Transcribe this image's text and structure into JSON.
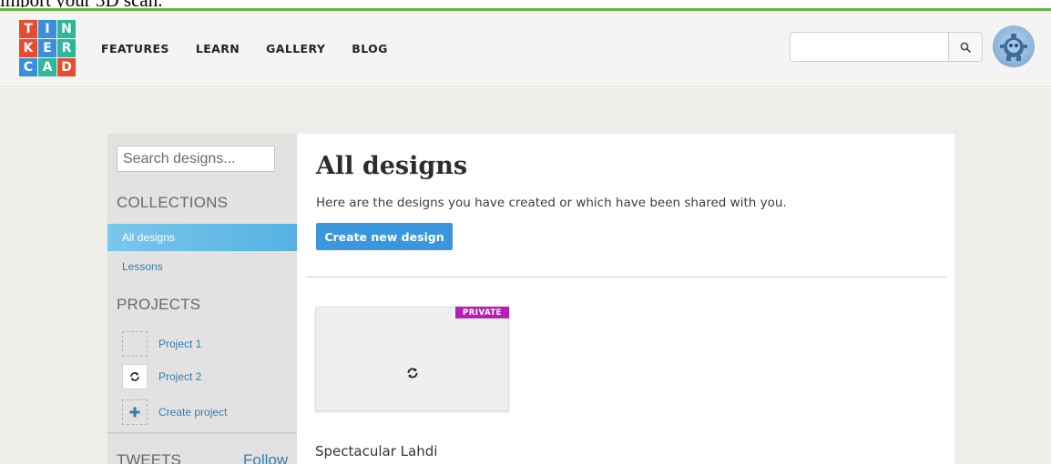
{
  "header_caption": "import your 3D scan.",
  "logo": {
    "letters": [
      "T",
      "I",
      "N",
      "K",
      "E",
      "R",
      "C",
      "A",
      "D"
    ],
    "colors": [
      "#e74c2e",
      "#3a8edb",
      "#2eb89a",
      "#e74c2e",
      "#3a8edb",
      "#2eb89a",
      "#3a8edb",
      "#2eb89a",
      "#e74c2e"
    ]
  },
  "nav": {
    "items": [
      "FEATURES",
      "LEARN",
      "GALLERY",
      "BLOG"
    ]
  },
  "top_search": {
    "placeholder": ""
  },
  "sidebar": {
    "search_placeholder": "Search designs...",
    "collections_heading": "COLLECTIONS",
    "collections": [
      "All designs",
      "Lessons"
    ],
    "projects_heading": "PROJECTS",
    "projects": [
      "Project 1",
      "Project 2"
    ],
    "create_project_label": "Create project",
    "tweets_heading": "TWEETS",
    "follow_label": "Follow"
  },
  "main": {
    "title": "All designs",
    "intro": "Here are the designs you have created or which have been shared with you.",
    "create_button": "Create new design",
    "design": {
      "badge": "PRIVATE",
      "name": "Spectacular Lahdi"
    }
  },
  "colors": {
    "accent": "#3a97dd",
    "active_item": "#55b2e2",
    "private_badge": "#b41fb6",
    "link": "#2f7fb6",
    "top_rule": "#5fb444"
  }
}
